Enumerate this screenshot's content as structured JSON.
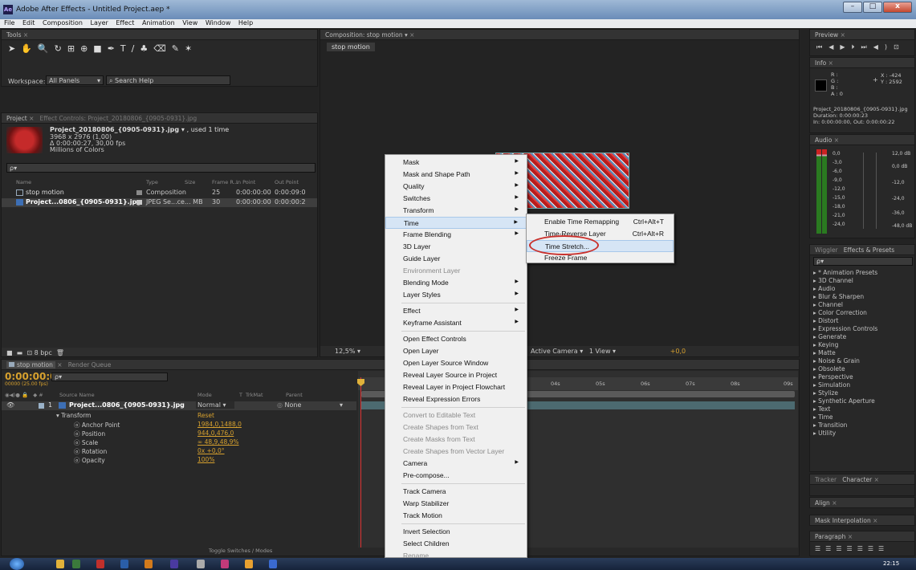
{
  "window": {
    "title": "Adobe After Effects - Untitled Project.aep *",
    "app_icon": "Ae",
    "min": "–",
    "max": "□",
    "close": "x"
  },
  "menubar": [
    "File",
    "Edit",
    "Composition",
    "Layer",
    "Effect",
    "Animation",
    "View",
    "Window",
    "Help"
  ],
  "tools": {
    "tab": "Tools",
    "workspace_label": "Workspace:",
    "workspace_value": "All Panels",
    "search_help": "Search Help"
  },
  "project": {
    "tab": "Project",
    "effect_controls_tab": "Effect Controls: Project_20180806_{0905-0931}.jpg",
    "item_name": "Project_20180806_{0905-0931}.jpg",
    "used": ", used 1 time",
    "dims": "3968 x 2976 (1,00)",
    "duration": "Δ 0:00:00:27, 30,00 fps",
    "colors": "Millions of Colors",
    "search_placeholder": "ρ▾",
    "headers": [
      "Name",
      "Type",
      "Size",
      "Frame R...",
      "In Point",
      "Out Point"
    ],
    "rows": [
      {
        "name": "stop motion",
        "type": "Composition",
        "size": "",
        "rate": "25",
        "in": "0:00:00:00",
        "out": "0:00:09:0"
      },
      {
        "name": "Project...0806_{0905-0931}.jpg",
        "type": "JPEG Se...ce",
        "size": "... MB",
        "rate": "30",
        "in": "0:00:00:00",
        "out": "0:00:00:2"
      }
    ],
    "bpc": "8 bpc"
  },
  "comp": {
    "tab": "Composition: stop motion",
    "subtab": "stop motion",
    "zoom": "12,5%",
    "camera": "Active Camera",
    "view": "1 View",
    "offset": "+0,0"
  },
  "timeline": {
    "tab": "stop motion",
    "render_tab": "Render Queue",
    "timecode": "0:00:00:00",
    "fps": "00000 (25.00 fps)",
    "headers": [
      "Source Name",
      "Mode",
      "T",
      "TrkMat",
      "Parent"
    ],
    "layer": {
      "num": "1",
      "name": "Project...0806_{0905-0931}.jpg",
      "mode": "Normal",
      "parent": "None"
    },
    "transform": "Transform",
    "reset": "Reset",
    "props": [
      {
        "name": "Anchor Point",
        "value": "1984,0,1488,0"
      },
      {
        "name": "Position",
        "value": "944,0,476,0"
      },
      {
        "name": "Scale",
        "value": "∞ 48,9,48,9%"
      },
      {
        "name": "Rotation",
        "value": "0x +0,0°"
      },
      {
        "name": "Opacity",
        "value": "100%"
      }
    ],
    "ruler": [
      "04s",
      "05s",
      "06s",
      "07s",
      "08s",
      "09s"
    ],
    "toggle": "Toggle Switches / Modes"
  },
  "preview": {
    "tab": "Preview"
  },
  "info": {
    "tab": "Info",
    "r": "R :",
    "g": "G :",
    "b": "B :",
    "a": "A : 0",
    "x": "X : -424",
    "y": "Y : 2592",
    "file": "Project_20180806_{0905-0931}.jpg",
    "duration": "Duration: 0:00:00:23",
    "inout": "In: 0:00:00:00, Out: 0:00:00:22"
  },
  "audio": {
    "tab": "Audio",
    "left": [
      "0,0",
      "-3,0",
      "-6,0",
      "-9,0",
      "-12,0",
      "-15,0",
      "-18,0",
      "-21,0",
      "-24,0"
    ],
    "right": [
      "12,0 dB",
      "0,0 dB",
      "-12,0",
      "-24,0",
      "-36,0",
      "-48,0 dB"
    ]
  },
  "effects": {
    "tab_wiggler": "Wiggler",
    "tab": "Effects & Presets",
    "search": "ρ▾",
    "items": [
      "* Animation Presets",
      "3D Channel",
      "Audio",
      "Blur & Sharpen",
      "Channel",
      "Color Correction",
      "Distort",
      "Expression Controls",
      "Generate",
      "Keying",
      "Matte",
      "Noise & Grain",
      "Obsolete",
      "Perspective",
      "Simulation",
      "Stylize",
      "Synthetic Aperture",
      "Text",
      "Time",
      "Transition",
      "Utility"
    ]
  },
  "side_panels": {
    "tracker": "Tracker",
    "character": "Character",
    "align": "Align",
    "mask_interp": "Mask Interpolation",
    "paragraph": "Paragraph"
  },
  "context_menu": {
    "items": [
      {
        "label": "Mask",
        "sub": true
      },
      {
        "label": "Mask and Shape Path",
        "sub": true
      },
      {
        "label": "Quality",
        "sub": true
      },
      {
        "label": "Switches",
        "sub": true
      },
      {
        "label": "Transform",
        "sub": true
      },
      {
        "label": "Time",
        "sub": true,
        "hl": true
      },
      {
        "label": "Frame Blending",
        "sub": true
      },
      {
        "label": "3D Layer"
      },
      {
        "label": "Guide Layer"
      },
      {
        "label": "Environment Layer",
        "dis": true
      },
      {
        "label": "Blending Mode",
        "sub": true
      },
      {
        "label": "Layer Styles",
        "sub": true
      },
      {
        "sep": true
      },
      {
        "label": "Effect",
        "sub": true
      },
      {
        "label": "Keyframe Assistant",
        "sub": true
      },
      {
        "sep": true
      },
      {
        "label": "Open Effect Controls"
      },
      {
        "label": "Open Layer"
      },
      {
        "label": "Open Layer Source Window"
      },
      {
        "label": "Reveal Layer Source in Project"
      },
      {
        "label": "Reveal Layer in Project Flowchart"
      },
      {
        "label": "Reveal Expression Errors"
      },
      {
        "sep": true
      },
      {
        "label": "Convert to Editable Text",
        "dis": true
      },
      {
        "label": "Create Shapes from Text",
        "dis": true
      },
      {
        "label": "Create Masks from Text",
        "dis": true
      },
      {
        "label": "Create Shapes from Vector Layer",
        "dis": true
      },
      {
        "label": "Camera",
        "sub": true
      },
      {
        "label": "Pre-compose..."
      },
      {
        "sep": true
      },
      {
        "label": "Track Camera"
      },
      {
        "label": "Warp Stabilizer"
      },
      {
        "label": "Track Motion"
      },
      {
        "sep": true
      },
      {
        "label": "Invert Selection"
      },
      {
        "label": "Select Children"
      },
      {
        "label": "Rename",
        "dis": true
      }
    ]
  },
  "submenu": {
    "items": [
      {
        "label": "Enable Time Remapping",
        "shortcut": "Ctrl+Alt+T"
      },
      {
        "label": "Time-Reverse Layer",
        "shortcut": "Ctrl+Alt+R"
      },
      {
        "label": "Time Stretch...",
        "shortcut": "",
        "hl": true
      },
      {
        "label": "Freeze Frame",
        "shortcut": ""
      }
    ]
  },
  "taskbar": {
    "time": "22:15"
  }
}
